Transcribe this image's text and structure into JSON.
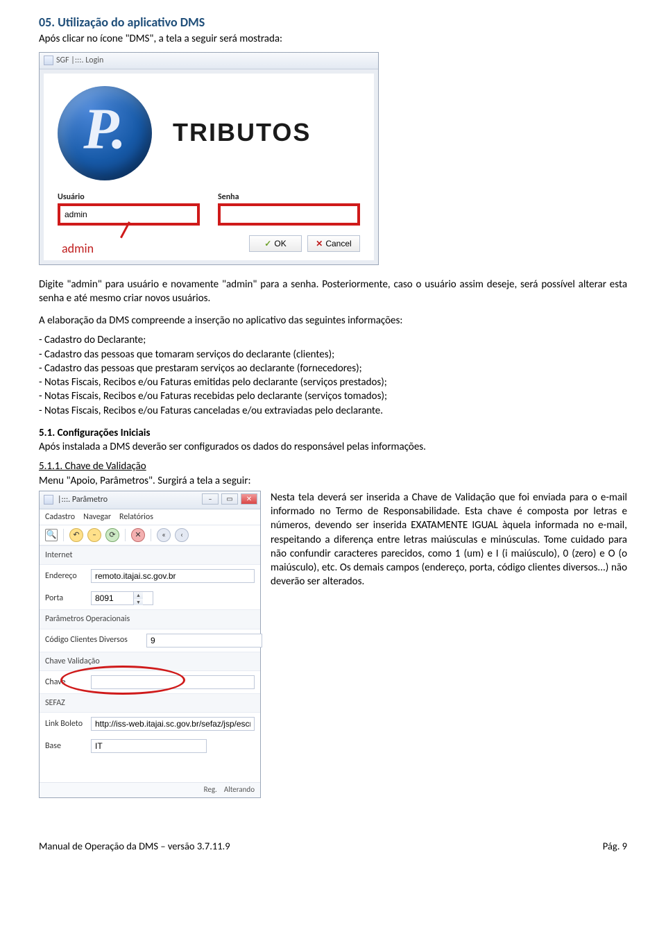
{
  "section": {
    "heading": "05. Utilização do aplicativo DMS",
    "intro": "Após clicar no ícone \"DMS\", a tela a seguir será mostrada:",
    "after_login": "Digite \"admin\" para usuário e novamente \"admin\" para a senha. Posteriormente, caso o usuário assim deseje, será possível alterar esta senha e até mesmo criar novos usuários.",
    "elab_intro": "A elaboração da DMS compreende a inserção no aplicativo das seguintes informações:",
    "bullets": [
      "- Cadastro do Declarante;",
      "- Cadastro das pessoas que tomaram serviços do declarante (clientes);",
      "- Cadastro das pessoas que prestaram serviços ao declarante (fornecedores);",
      "- Notas Fiscais, Recibos e/ou Faturas emitidas pelo declarante (serviços prestados);",
      "- Notas Fiscais, Recibos e/ou Faturas recebidas pelo declarante (serviços tomados);",
      "- Notas Fiscais, Recibos e/ou Faturas canceladas e/ou extraviadas pelo declarante."
    ]
  },
  "sub51": {
    "title": "5.1. Configurações Iniciais",
    "body": "Após instalada a DMS deverão ser configurados os dados do responsável pelas informações."
  },
  "sub511": {
    "title": "5.1.1. Chave de Validação",
    "body": "Menu \"Apoio, Parâmetros\". Surgirá a tela a seguir:"
  },
  "login_window": {
    "title": "SGF |:::. Login",
    "brand": "TRIBUTOS",
    "user_label": "Usuário",
    "pass_label": "Senha",
    "user_value": "admin",
    "ok_label": "OK",
    "cancel_label": "Cancel",
    "callout": "admin"
  },
  "param_window": {
    "title": "|:::. Parâmetro",
    "menu": [
      "Cadastro",
      "Navegar",
      "Relatórios"
    ],
    "groups": {
      "internet": "Internet",
      "oper": "Parâmetros Operacionais",
      "chave": "Chave Validação",
      "sefaz": "SEFAZ"
    },
    "fields": {
      "endereco_label": "Endereço",
      "endereco_value": "remoto.itajai.sc.gov.br",
      "porta_label": "Porta",
      "porta_value": "8091",
      "codigo_label": "Código Clientes Diversos",
      "codigo_value": "9",
      "chave_label": "Chave",
      "link_label": "Link Boleto",
      "link_value": "http://iss-web.itajai.sc.gov.br/sefaz/jsp/escritura",
      "base_label": "Base",
      "base_value": "IT"
    },
    "status": {
      "reg": "Reg.",
      "mode": "Alterando"
    }
  },
  "right_text": "Nesta tela deverá ser inserida a Chave de Validação que foi enviada para o e-mail informado no Termo de Responsabilidade. Esta chave é composta por letras e números, devendo ser inserida EXATAMENTE IGUAL àquela informada no e-mail, respeitando a diferença entre letras maiúsculas e minúsculas. Tome cuidado para não confundir caracteres parecidos, como 1 (um) e I (i maiúsculo), 0 (zero) e O (o maiúsculo), etc. Os demais campos (endereço, porta, código clientes diversos...) não deverão ser alterados.",
  "footer": {
    "left": "Manual de Operação da DMS – versão 3.7.11.9",
    "right": "Pág. 9"
  }
}
